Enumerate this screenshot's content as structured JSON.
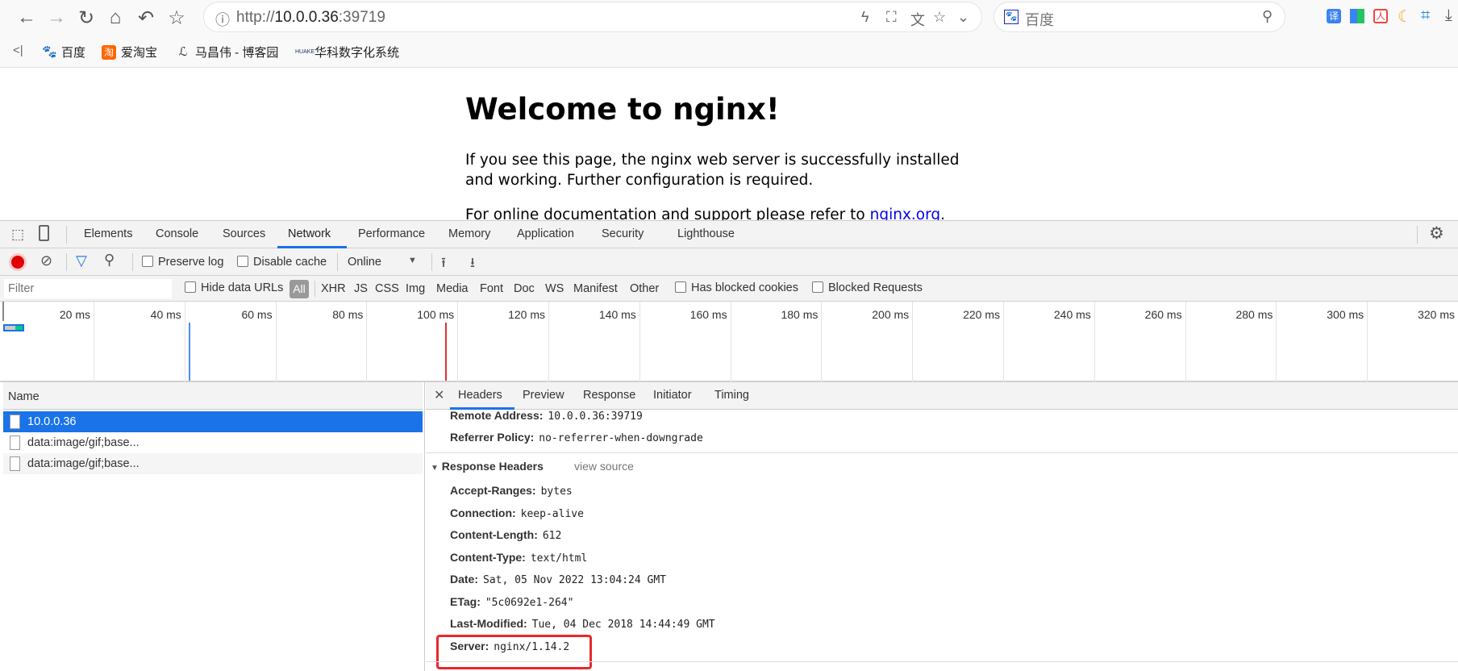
{
  "browser": {
    "url_prefix": "http://",
    "url_host": "10.0.0.36",
    "url_port": ":39719",
    "search_placeholder": "百度",
    "bookmarks": [
      {
        "label": "百度"
      },
      {
        "label": "爱淘宝"
      },
      {
        "label": "马昌伟 - 博客园"
      },
      {
        "label": "华科数字化系统"
      }
    ],
    "nav_icons": [
      "back-icon",
      "forward-icon",
      "reload-icon",
      "home-icon",
      "undo-icon",
      "star-icon"
    ]
  },
  "page": {
    "title": "Welcome to nginx!",
    "para1": "If you see this page, the nginx web server is successfully installed and working. Further configuration is required.",
    "para2_prefix": "For online documentation and support please refer to ",
    "para2_link": "nginx.org",
    "para2_suffix": "."
  },
  "devtools": {
    "tabs": [
      "Elements",
      "Console",
      "Sources",
      "Network",
      "Performance",
      "Memory",
      "Application",
      "Security",
      "Lighthouse"
    ],
    "active_tab": "Network",
    "toolbar": {
      "preserve_log": "Preserve log",
      "disable_cache": "Disable cache",
      "throttle": "Online"
    },
    "filter": {
      "placeholder": "Filter",
      "hide_data_urls": "Hide data URLs",
      "types": [
        "All",
        "XHR",
        "JS",
        "CSS",
        "Img",
        "Media",
        "Font",
        "Doc",
        "WS",
        "Manifest",
        "Other"
      ],
      "has_blocked_cookies": "Has blocked cookies",
      "blocked_requests": "Blocked Requests"
    },
    "timeline_ticks": [
      "20 ms",
      "40 ms",
      "60 ms",
      "80 ms",
      "100 ms",
      "120 ms",
      "140 ms",
      "160 ms",
      "180 ms",
      "200 ms",
      "220 ms",
      "240 ms",
      "260 ms",
      "280 ms",
      "300 ms",
      "320 ms"
    ],
    "requests": {
      "header": "Name",
      "rows": [
        {
          "name": "10.0.0.36",
          "selected": true
        },
        {
          "name": "data:image/gif;base..."
        },
        {
          "name": "data:image/gif;base..."
        }
      ]
    },
    "detail_tabs": [
      "Headers",
      "Preview",
      "Response",
      "Initiator",
      "Timing"
    ],
    "general": [
      {
        "k": "Remote Address:",
        "v": "10.0.0.36:39719"
      },
      {
        "k": "Referrer Policy:",
        "v": "no-referrer-when-downgrade"
      }
    ],
    "response_headers": {
      "title": "Response Headers",
      "view_source": "view source",
      "items": [
        {
          "k": "Accept-Ranges:",
          "v": "bytes"
        },
        {
          "k": "Connection:",
          "v": "keep-alive"
        },
        {
          "k": "Content-Length:",
          "v": "612"
        },
        {
          "k": "Content-Type:",
          "v": "text/html"
        },
        {
          "k": "Date:",
          "v": "Sat, 05 Nov 2022 13:04:24 GMT"
        },
        {
          "k": "ETag:",
          "v": "\"5c0692e1-264\""
        },
        {
          "k": "Last-Modified:",
          "v": "Tue, 04 Dec 2018 14:44:49 GMT"
        },
        {
          "k": "Server:",
          "v": "nginx/1.14.2"
        }
      ]
    },
    "colors": {
      "accent": "#1a73e8",
      "highlight_box": "#e8282b",
      "record": "#e00000"
    }
  }
}
